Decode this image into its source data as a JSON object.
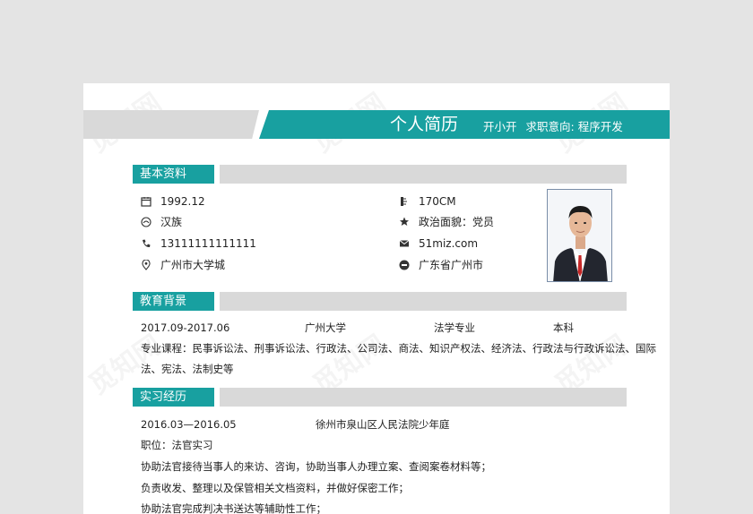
{
  "header": {
    "title": "个人简历",
    "name": "开小开",
    "objective": "求职意向: 程序开发"
  },
  "sections": {
    "basic": "基本资料",
    "education": "教育背景",
    "internship": "实习经历"
  },
  "basic_info": {
    "birth": "1992.12",
    "ethnicity": "汉族",
    "phone": "13111111111111",
    "address": "广州市大学城",
    "height": "170CM",
    "politics": "政治面貌：党员",
    "email": "51miz.com",
    "native": "广东省广州市"
  },
  "education": {
    "period": "2017.09-2017.06",
    "school": "广州大学",
    "major": "法学专业",
    "degree": "本科",
    "courses_line1": "专业课程：民事诉讼法、刑事诉讼法、行政法、公司法、商法、知识产权法、经济法、行政法与行政诉讼法、国际",
    "courses_line2": "法、宪法、法制史等"
  },
  "internship": {
    "period": "2016.03—2016.05",
    "org": "徐州市泉山区人民法院少年庭",
    "position": "职位：法官实习",
    "duty1": "协助法官接待当事人的来访、咨询，协助当事人办理立案、查阅案卷材料等；",
    "duty2": "负责收发、整理以及保管相关文档资料，并做好保密工作；",
    "duty3": "协助法官完成判决书送达等辅助性工作；"
  },
  "watermark": "觅知网",
  "colors": {
    "accent": "#18a0a0",
    "bar": "#d9d9d9",
    "background": "#e4e4e4"
  }
}
